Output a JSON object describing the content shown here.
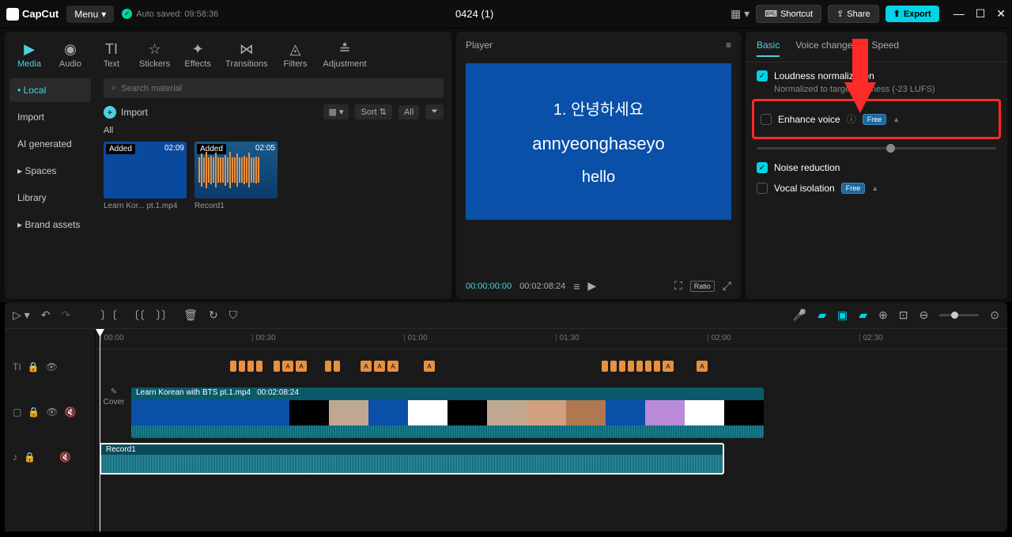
{
  "app": {
    "name": "CapCut",
    "menu": "Menu",
    "auto_saved": "Auto saved: 09:58:36",
    "project": "0424 (1)"
  },
  "topbtns": {
    "shortcut": "Shortcut",
    "share": "Share",
    "export": "Export"
  },
  "tabs": {
    "media": "Media",
    "audio": "Audio",
    "text": "Text",
    "stickers": "Stickers",
    "effects": "Effects",
    "transitions": "Transitions",
    "filters": "Filters",
    "adjustment": "Adjustment"
  },
  "sidebar": {
    "local": "Local",
    "import": "Import",
    "ai": "AI generated",
    "spaces": "Spaces",
    "library": "Library",
    "brand": "Brand assets"
  },
  "media": {
    "search_placeholder": "Search material",
    "import": "Import",
    "sort": "Sort",
    "all": "All",
    "section": "All",
    "items": [
      {
        "badge": "Added",
        "time": "02:09",
        "name": "Learn Kor... pt.1.mp4"
      },
      {
        "badge": "Added",
        "time": "02:05",
        "name": "Record1"
      }
    ]
  },
  "player": {
    "title": "Player",
    "line1": "1. 안녕하세요",
    "line2": "annyeonghaseyo",
    "line3": "hello",
    "current": "00:00:00:00",
    "total": "00:02:08:24",
    "ratio": "Ratio"
  },
  "inspector": {
    "tabs": {
      "basic": "Basic",
      "voice_changer": "Voice changer",
      "speed": "Speed"
    },
    "loudness": "Loudness normalization",
    "loudness_sub": "Normalized to target loudness (-23 LUFS)",
    "enhance": "Enhance voice",
    "free": "Free",
    "noise": "Noise reduction",
    "vocal": "Vocal isolation"
  },
  "timeline": {
    "ruler": [
      "00:00",
      "00:30",
      "01:00",
      "01:30",
      "02:00",
      "02:30"
    ],
    "cover": "Cover",
    "clip_name": "Learn Korean with BTS pt.1.mp4",
    "clip_dur": "00:02:08:24",
    "audio_name": "Record1",
    "thumb_colors": [
      "#0a4fa8",
      "#0a4fa8",
      "#0a4fa8",
      "#0a4fa8",
      "#000",
      "#c0a890",
      "#0a4fa8",
      "#fff",
      "#000",
      "#c0a890",
      "#d0a080",
      "#b07850",
      "#0a4fa8",
      "#b88ad8",
      "#fff",
      "#000"
    ]
  }
}
